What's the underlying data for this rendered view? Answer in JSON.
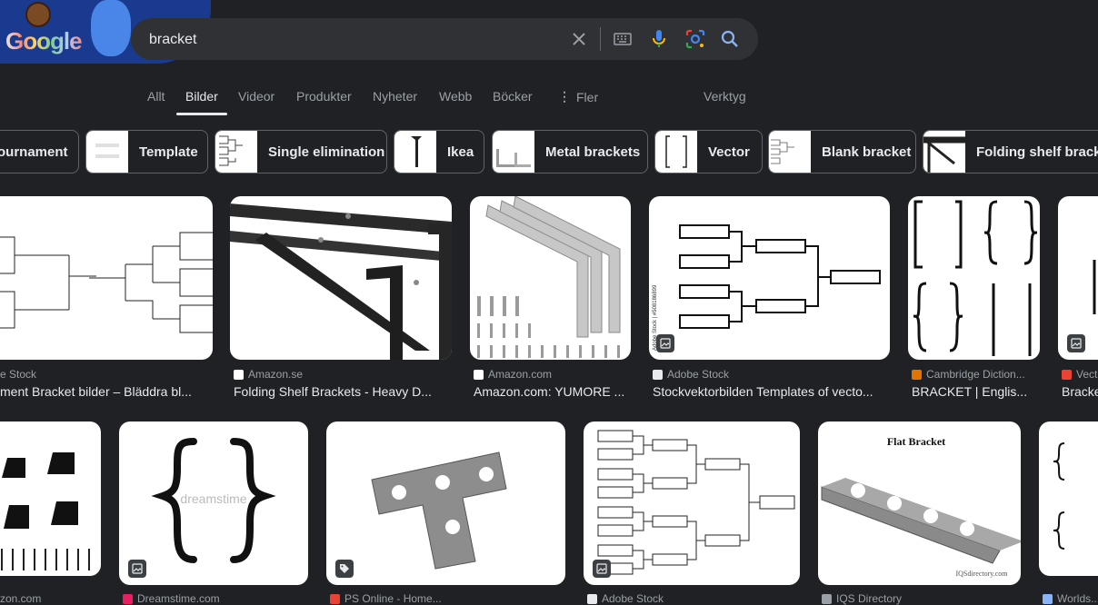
{
  "search": {
    "query": "bracket"
  },
  "logo": {
    "text": "Google"
  },
  "tabs": [
    {
      "label": "Allt"
    },
    {
      "label": "Bilder"
    },
    {
      "label": "Videor"
    },
    {
      "label": "Produkter"
    },
    {
      "label": "Nyheter"
    },
    {
      "label": "Webb"
    },
    {
      "label": "Böcker"
    },
    {
      "label": "Fler"
    }
  ],
  "tools_label": "Verktyg",
  "chips": [
    {
      "label": "ournament"
    },
    {
      "label": "Template"
    },
    {
      "label": "Single elimination"
    },
    {
      "label": "Ikea"
    },
    {
      "label": "Metal brackets"
    },
    {
      "label": "Vector"
    },
    {
      "label": "Blank bracket"
    },
    {
      "label": "Folding shelf bracket"
    }
  ],
  "row1": [
    {
      "source": "e Stock",
      "title": "ment Bracket bilder – Bläddra bl..."
    },
    {
      "source": "Amazon.se",
      "title": "Folding Shelf Brackets - Heavy D..."
    },
    {
      "source": "Amazon.com",
      "title": "Amazon.com: YUMORE ..."
    },
    {
      "source": "Adobe Stock",
      "title": "Stockvektorbilden Templates of vecto..."
    },
    {
      "source": "Cambridge Diction...",
      "title": "BRACKET | Englis..."
    },
    {
      "source": "Vecte",
      "title": "Bracke"
    }
  ],
  "row2": [
    {
      "source": "zon.com"
    },
    {
      "source": "Dreamstime.com"
    },
    {
      "source": "PS Online - Home..."
    },
    {
      "source": "Adobe Stock"
    },
    {
      "source": "IQS Directory"
    },
    {
      "source": "Worlds..."
    }
  ],
  "image_text": {
    "flat_bracket": "Flat Bracket",
    "iqs": "IQSdirectory.com",
    "adobe_vertical": "Adobe Stock | #508186899",
    "dreamstime_wm": "dreamstime"
  },
  "colors": {
    "bg": "#202124",
    "search_bg": "#303134",
    "text": "#e8eaed",
    "muted": "#9aa0a6",
    "mic": "#4285f4",
    "lens": "#ea4335",
    "search_icon": "#8ab4f8"
  }
}
